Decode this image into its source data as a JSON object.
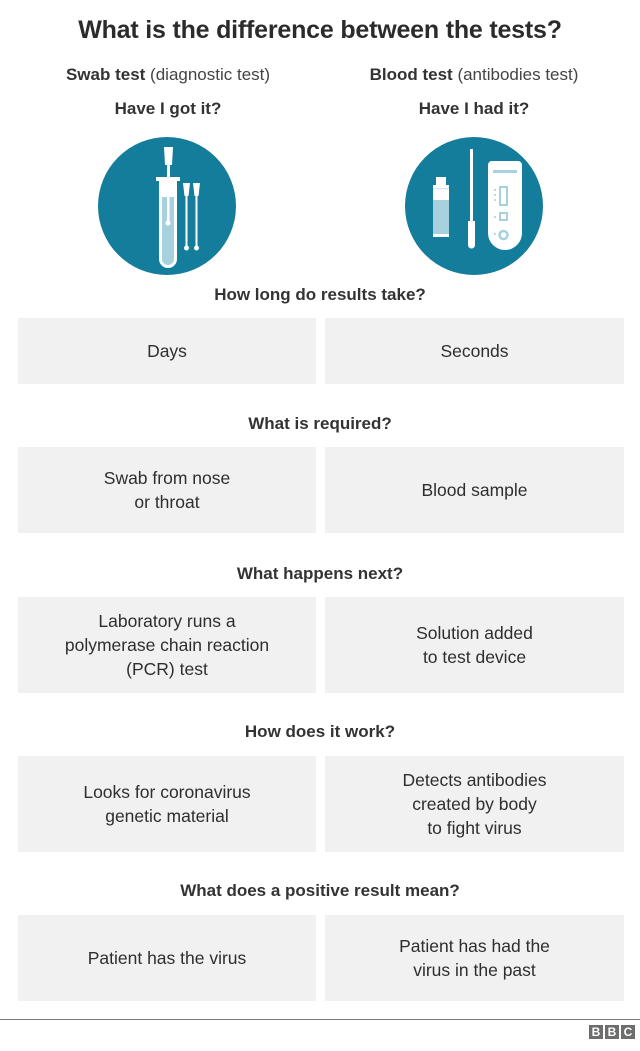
{
  "title": "What is the difference between the tests?",
  "columns": [
    {
      "name": "Swab test",
      "subtitle": "(diagnostic test)",
      "question": "Have I got it?",
      "icon": "swab-test-tube-icon"
    },
    {
      "name": "Blood test",
      "subtitle": "(antibodies test)",
      "question": "Have I had it?",
      "icon": "blood-test-kit-icon"
    }
  ],
  "sections": [
    {
      "title": "How long do results take?",
      "swab": "Days",
      "blood": "Seconds"
    },
    {
      "title": "What is required?",
      "swab": "Swab from nose\nor throat",
      "blood": "Blood sample"
    },
    {
      "title": "What happens next?",
      "swab": "Laboratory runs a\npolymerase chain reaction\n(PCR) test",
      "blood": "Solution added\nto test device"
    },
    {
      "title": "How does it work?",
      "swab": "Looks for coronavirus\ngenetic material",
      "blood": "Detects antibodies\ncreated by body\nto fight virus"
    },
    {
      "title": "What does a positive result mean?",
      "swab": "Patient has the virus",
      "blood": "Patient has had the\nvirus in the past"
    }
  ],
  "footer": {
    "logo_letters": [
      "B",
      "B",
      "C"
    ]
  },
  "colors": {
    "icon_circle": "#157d9c",
    "icon_white": "#ffffff",
    "icon_fill_light": "#a8d1de",
    "cell_bg": "#f1f1f1"
  }
}
